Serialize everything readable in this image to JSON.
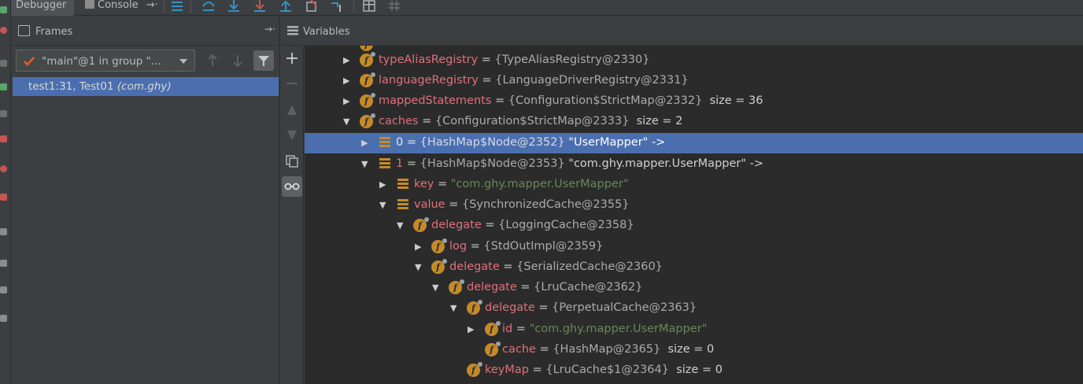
{
  "tabs": {
    "debugger": "Debugger",
    "console": "Console"
  },
  "frames": {
    "title": "Frames",
    "thread": "\"main\"@1 in group \"...",
    "selected_frame": "test1:31, Test01",
    "selected_frame_pkg": "(com.ghy)"
  },
  "variables": {
    "title": "Variables",
    "rows": [
      {
        "name": "typeAliasRegistry",
        "value": "{TypeAliasRegistry@2330}",
        "extra": ""
      },
      {
        "name": "languageRegistry",
        "value": "{LanguageDriverRegistry@2331}",
        "extra": ""
      },
      {
        "name": "mappedStatements",
        "value": "{Configuration$StrictMap@2332}",
        "extra": "size = 36"
      },
      {
        "name": "caches",
        "value": "{Configuration$StrictMap@2333}",
        "extra": "size = 2"
      },
      {
        "name": "0",
        "value": "{HashMap$Node@2352}",
        "extra": "\"UserMapper\" ->"
      },
      {
        "name": "1",
        "value": "{HashMap$Node@2353}",
        "extra": "\"com.ghy.mapper.UserMapper\" ->"
      },
      {
        "name": "key",
        "value": "\"com.ghy.mapper.UserMapper\"",
        "extra": ""
      },
      {
        "name": "value",
        "value": "{SynchronizedCache@2355}",
        "extra": ""
      },
      {
        "name": "delegate",
        "value": "{LoggingCache@2358}",
        "extra": ""
      },
      {
        "name": "log",
        "value": "{StdOutImpl@2359}",
        "extra": ""
      },
      {
        "name": "delegate",
        "value": "{SerializedCache@2360}",
        "extra": ""
      },
      {
        "name": "delegate",
        "value": "{LruCache@2362}",
        "extra": ""
      },
      {
        "name": "delegate",
        "value": "{PerpetualCache@2363}",
        "extra": ""
      },
      {
        "name": "id",
        "value": "\"com.ghy.mapper.UserMapper\"",
        "extra": ""
      },
      {
        "name": "cache",
        "value": "{HashMap@2365}",
        "extra": "size = 0"
      },
      {
        "name": "keyMap",
        "value": "{LruCache$1@2364}",
        "extra": "size = 0"
      }
    ]
  },
  "colors": {
    "selection": "#4b6eaf",
    "field_icon": "#c48a2a",
    "field_name": "#e0707a",
    "string": "#6a8759"
  }
}
